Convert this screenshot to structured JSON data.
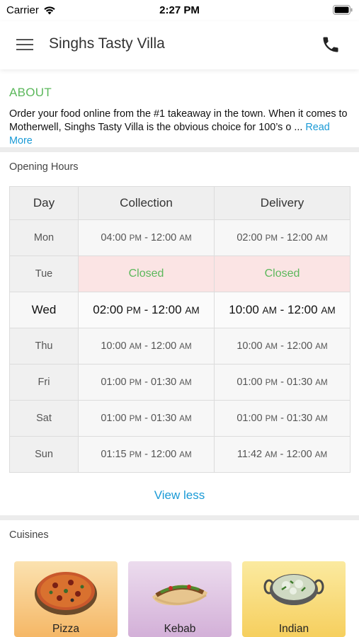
{
  "status_bar": {
    "carrier": "Carrier",
    "time": "2:27 PM"
  },
  "app_bar": {
    "title": "Singhs Tasty Villa",
    "menu_icon": "hamburger-menu-icon",
    "call_icon": "phone-icon"
  },
  "about": {
    "heading": "ABOUT",
    "text": "Order your food online from the #1 takeaway in the town. When it comes to Motherwell, Singhs Tasty Villa is the obvious choice for 100’s o ... ",
    "read_more": "Read More",
    "heading_color": "#5cb85c",
    "link_color": "#1a9ad6"
  },
  "opening_hours": {
    "label": "Opening Hours",
    "columns": [
      "Day",
      "Collection",
      "Delivery"
    ],
    "rows": [
      {
        "day": "Mon",
        "collection": [
          "04:00",
          "PM",
          "12:00",
          "AM"
        ],
        "delivery": [
          "02:00",
          "PM",
          "12:00",
          "AM"
        ]
      },
      {
        "day": "Tue",
        "collection_text": "Closed",
        "delivery_text": "Closed"
      },
      {
        "day": "Wed",
        "collection": [
          "02:00",
          "PM",
          "12:00",
          "AM"
        ],
        "delivery": [
          "10:00",
          "AM",
          "12:00",
          "AM"
        ]
      },
      {
        "day": "Thu",
        "collection": [
          "10:00",
          "AM",
          "12:00",
          "AM"
        ],
        "delivery": [
          "10:00",
          "AM",
          "12:00",
          "AM"
        ]
      },
      {
        "day": "Fri",
        "collection": [
          "01:00",
          "PM",
          "01:30",
          "AM"
        ],
        "delivery": [
          "01:00",
          "PM",
          "01:30",
          "AM"
        ]
      },
      {
        "day": "Sat",
        "collection": [
          "01:00",
          "PM",
          "01:30",
          "AM"
        ],
        "delivery": [
          "01:00",
          "PM",
          "01:30",
          "AM"
        ]
      },
      {
        "day": "Sun",
        "collection": [
          "01:15",
          "PM",
          "12:00",
          "AM"
        ],
        "delivery": [
          "11:42",
          "AM",
          "12:00",
          "AM"
        ]
      }
    ],
    "view_less": "View less"
  },
  "cuisines": {
    "label": "Cuisines",
    "items": [
      {
        "name": "Pizza",
        "icon": "pizza-icon"
      },
      {
        "name": "Kebab",
        "icon": "kebab-icon"
      },
      {
        "name": "Indian",
        "icon": "curry-icon"
      }
    ]
  }
}
